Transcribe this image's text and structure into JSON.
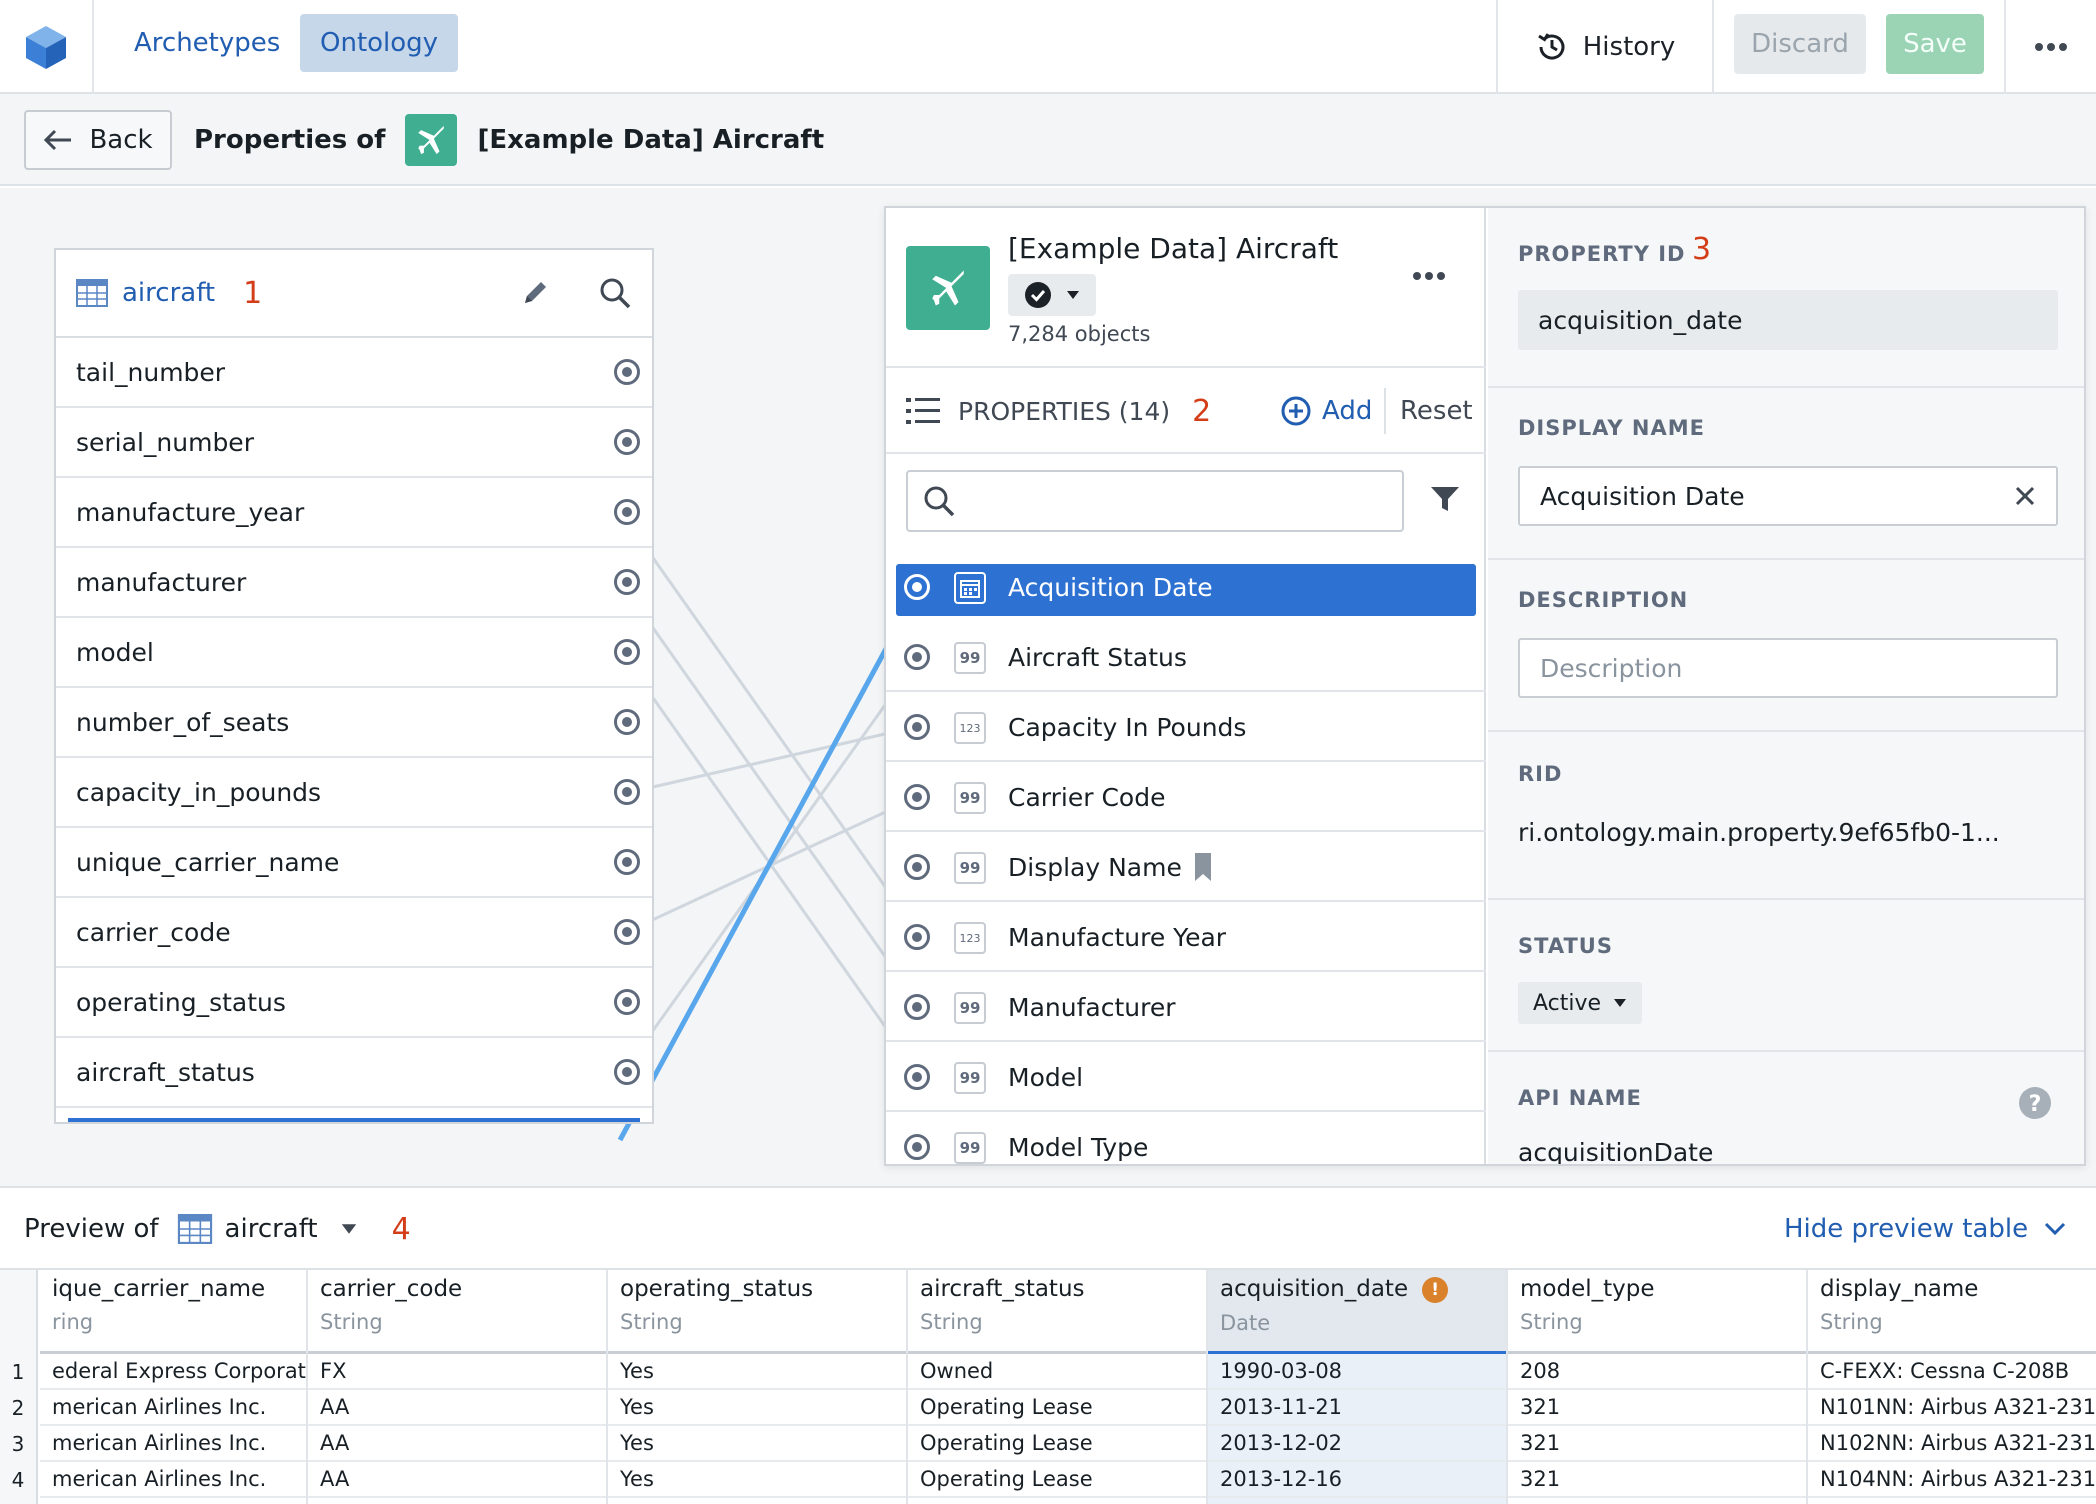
{
  "nav": {
    "tabs": [
      {
        "label": "Archetypes"
      },
      {
        "label": "Ontology"
      }
    ],
    "history_label": "History",
    "discard_label": "Discard",
    "save_label": "Save"
  },
  "breadcrumb": {
    "back_label": "Back",
    "prefix": "Properties of",
    "object_name": "[Example Data] Aircraft"
  },
  "dataset": {
    "name": "aircraft",
    "marker": "1",
    "columns": [
      "tail_number",
      "serial_number",
      "manufacture_year",
      "manufacturer",
      "model",
      "number_of_seats",
      "capacity_in_pounds",
      "unique_carrier_name",
      "carrier_code",
      "operating_status",
      "aircraft_status"
    ]
  },
  "object": {
    "name": "[Example Data] Aircraft",
    "count": "7,284 objects",
    "properties_label": "PROPERTIES (14)",
    "marker": "2",
    "add_label": "Add",
    "reset_label": "Reset",
    "search_placeholder": "",
    "properties": [
      {
        "name": "Acquisition Date",
        "type_icon": "calendar-icon",
        "selected": true
      },
      {
        "name": "Aircraft Status",
        "type_icon": "quote-icon"
      },
      {
        "name": "Capacity In Pounds",
        "type_icon": "number-icon",
        "type_text": "123"
      },
      {
        "name": "Carrier Code",
        "type_icon": "quote-icon"
      },
      {
        "name": "Display Name",
        "type_icon": "quote-icon",
        "bookmark": true
      },
      {
        "name": "Manufacture Year",
        "type_icon": "number-icon",
        "type_text": "123"
      },
      {
        "name": "Manufacturer",
        "type_icon": "quote-icon"
      },
      {
        "name": "Model",
        "type_icon": "quote-icon"
      },
      {
        "name": "Model Type",
        "type_icon": "quote-icon"
      }
    ]
  },
  "detail": {
    "marker": "3",
    "property_id_label": "PROPERTY ID",
    "property_id": "acquisition_date",
    "display_name_label": "DISPLAY NAME",
    "display_name": "Acquisition Date",
    "description_label": "DESCRIPTION",
    "description_placeholder": "Description",
    "rid_label": "RID",
    "rid": "ri.ontology.main.property.9ef65fb0-1...",
    "status_label": "STATUS",
    "status": "Active",
    "api_name_label": "API NAME",
    "api_name": "acquisitionDate"
  },
  "preview": {
    "prefix": "Preview of",
    "dataset": "aircraft",
    "marker": "4",
    "hide_label": "Hide preview table",
    "row_numbers": [
      "1",
      "2",
      "3",
      "4"
    ],
    "columns": [
      {
        "name": "ique_carrier_name",
        "type": "ring",
        "cells": [
          "ederal Express Corporation",
          "merican Airlines Inc.",
          "merican Airlines Inc.",
          "merican Airlines Inc."
        ]
      },
      {
        "name": "carrier_code",
        "type": "String",
        "cells": [
          "FX",
          "AA",
          "AA",
          "AA"
        ]
      },
      {
        "name": "operating_status",
        "type": "String",
        "cells": [
          "Yes",
          "Yes",
          "Yes",
          "Yes"
        ]
      },
      {
        "name": "aircraft_status",
        "type": "String",
        "cells": [
          "Owned",
          "Operating Lease",
          "Operating Lease",
          "Operating Lease"
        ]
      },
      {
        "name": "acquisition_date",
        "type": "Date",
        "cells": [
          "1990-03-08",
          "2013-11-21",
          "2013-12-02",
          "2013-12-16"
        ],
        "warning": "!"
      },
      {
        "name": "model_type",
        "type": "String",
        "cells": [
          "208",
          "321",
          "321",
          "321"
        ]
      },
      {
        "name": "display_name",
        "type": "String",
        "cells": [
          "C-FEXX: Cessna C-208B",
          "N101NN: Airbus A321-231",
          "N102NN: Airbus A321-231",
          "N104NN: Airbus A321-231"
        ]
      }
    ]
  },
  "colors": {
    "accent": "#2d72d2",
    "link": "#215db0",
    "object_icon": "#3fae91",
    "marker": "#d33d17"
  }
}
